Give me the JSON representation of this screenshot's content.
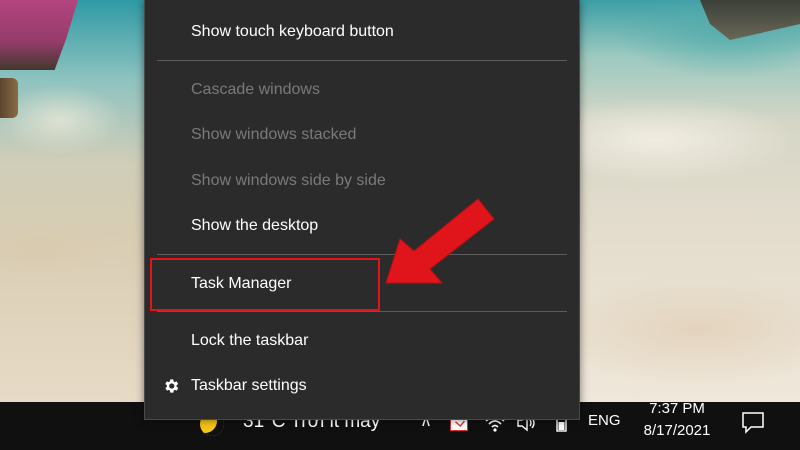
{
  "menu": {
    "items": [
      {
        "label": "Show touch keyboard button",
        "enabled": true
      },
      {
        "label": "Cascade windows",
        "enabled": false
      },
      {
        "label": "Show windows stacked",
        "enabled": false
      },
      {
        "label": "Show windows side by side",
        "enabled": false
      },
      {
        "label": "Show the desktop",
        "enabled": true
      },
      {
        "label": "Task Manager",
        "enabled": true,
        "highlighted": true
      },
      {
        "label": "Lock the taskbar",
        "enabled": true
      },
      {
        "label": "Taskbar settings",
        "enabled": true,
        "icon": "gear-icon"
      }
    ]
  },
  "taskbar": {
    "weather": {
      "temperature": "31°C",
      "condition": "Trời it mây",
      "icon": "moon-icon"
    },
    "tray_icons": [
      "chevron-up-icon",
      "flag-icon",
      "wifi-icon",
      "volume-icon",
      "battery-icon"
    ],
    "language": "ENG",
    "time": "7:37 PM",
    "date": "8/17/2021",
    "notification_icon": "action-center-icon"
  },
  "colors": {
    "menu_bg": "#2b2b2b",
    "menu_text": "#ffffff",
    "menu_disabled": "#7a7a7a",
    "highlight": "#e0151b",
    "taskbar_bg": "#101010"
  }
}
